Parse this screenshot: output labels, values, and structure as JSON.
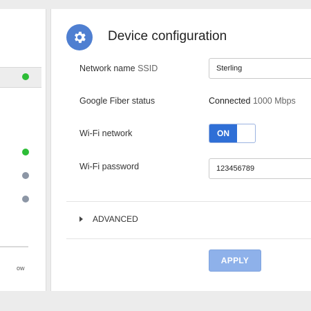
{
  "sidebar": {
    "clipped_text": "ow",
    "status_dots": [
      {
        "color": "#2dbd37"
      },
      {
        "color": "#2dbd37"
      },
      {
        "color": "#8c96a5"
      },
      {
        "color": "#8c96a5"
      }
    ]
  },
  "header": {
    "icon": "gear-icon",
    "title": "Device configuration"
  },
  "form": {
    "ssid_label": "Network name",
    "ssid_label_suffix": "SSID",
    "ssid_value": "Sterling",
    "fiber_label": "Google Fiber status",
    "fiber_status": "Connected",
    "fiber_speed": "1000 Mbps",
    "wifi_label": "Wi-Fi network",
    "wifi_toggle": "ON",
    "password_label": "Wi-Fi password",
    "password_value": "123456789"
  },
  "advanced": {
    "label": "ADVANCED"
  },
  "actions": {
    "apply_label": "APPLY"
  },
  "colors": {
    "accent": "#2f6fd6",
    "gear_bg": "#4f7fd1",
    "apply_disabled": "#8eb1ea",
    "status_green": "#2dbd37",
    "status_gray": "#8c96a5"
  }
}
